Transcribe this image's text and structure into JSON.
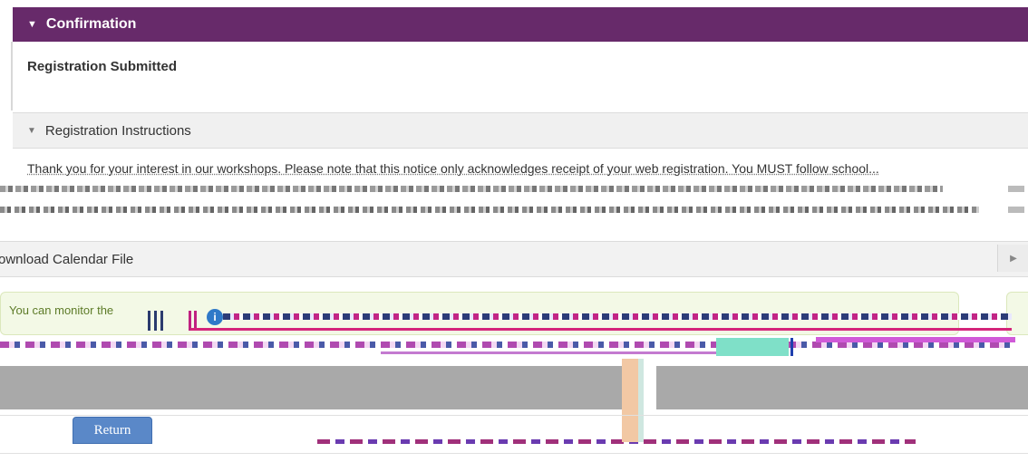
{
  "confirmation": {
    "title": "Confirmation",
    "icon": "caret-down-icon"
  },
  "registration_submitted": "Registration Submitted",
  "instructions": {
    "title": "Registration Instructions",
    "icon": "caret-down-icon"
  },
  "notice_text": "Thank you for your interest in our workshops. Please note that this notice only acknowledges receipt of your web registration. You MUST follow school...",
  "download": {
    "label": "ownload Calendar File",
    "icon": "caret-right-icon"
  },
  "monitor": {
    "text": "You can monitor the",
    "icon": "info-icon"
  },
  "actions": {
    "return_label": "Return"
  },
  "colors": {
    "header": "#672a6a",
    "button": "#5a88c8",
    "notice_bg": "#f3f9e6"
  }
}
